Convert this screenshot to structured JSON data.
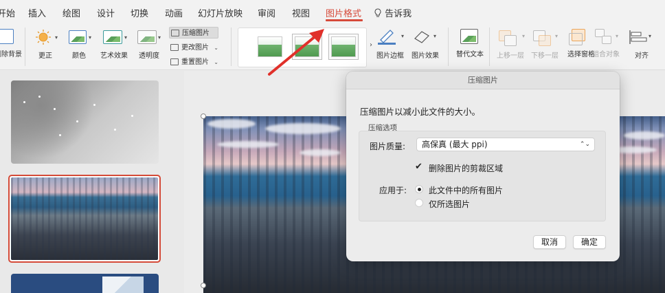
{
  "menu": {
    "tabs": [
      "开始",
      "插入",
      "绘图",
      "设计",
      "切换",
      "动画",
      "幻灯片放映",
      "审阅",
      "视图",
      "图片格式"
    ],
    "active_tab": "图片格式",
    "tell_me": "告诉我"
  },
  "ribbon": {
    "remove_background": "删除背景",
    "corrections": "更正",
    "color": "颜色",
    "artistic_effects": "艺术效果",
    "transparency": "透明度",
    "compress_pictures": "压缩图片",
    "change_picture": "更改图片",
    "reset_picture": "重置图片",
    "picture_border": "图片边框",
    "picture_effects": "图片效果",
    "alt_text": "替代文本",
    "bring_forward": "上移一层",
    "send_backward": "下移一层",
    "selection_pane": "选择窗格",
    "group_objects": "组合对象",
    "align": "对齐"
  },
  "dialog": {
    "title": "压缩图片",
    "description": "压缩图片以减小此文件的大小。",
    "options_group": "压缩选项",
    "quality_label": "图片质量:",
    "quality_value": "高保真 (最大 ppi)",
    "delete_cropped": "删除图片的剪裁区域",
    "delete_cropped_checked": true,
    "apply_to_label": "应用于:",
    "apply_all": "此文件中的所有图片",
    "apply_selected": "仅所选图片",
    "apply_choice": "all",
    "cancel": "取消",
    "ok": "确定"
  },
  "colors": {
    "accent": "#d64a3a",
    "selected_slide_border": "#d44a38"
  }
}
